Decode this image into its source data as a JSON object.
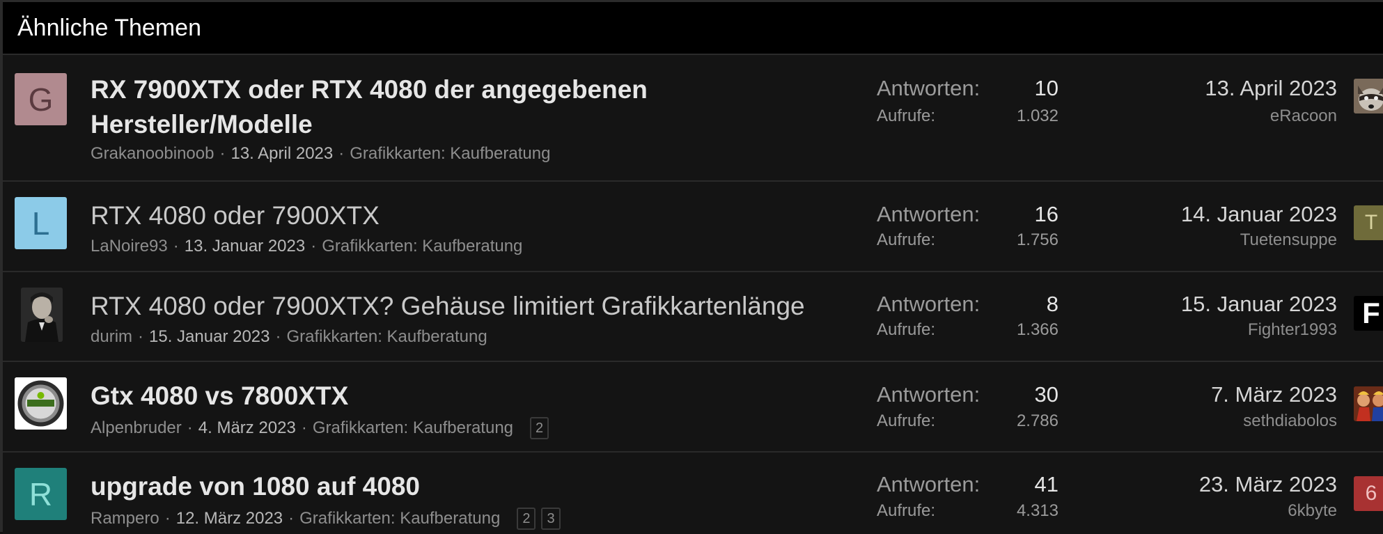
{
  "block": {
    "title": "Ähnliche Themen"
  },
  "labels": {
    "replies": "Antworten:",
    "views": "Aufrufe:"
  },
  "threads": [
    {
      "avatar_letter": "G",
      "avatar_bg": "#b18a8f",
      "avatar_fg": "#5a3a3f",
      "title_line1": "RX 7900XTX oder RTX 4080 der angegebenen",
      "title_line2": "Hersteller/Modelle",
      "author": "Grakanoobinoob",
      "date": "13. April 2023",
      "forum": "Grafikkarten: Kaufberatung",
      "replies": "10",
      "views": "1.032",
      "last_date": "13. April 2023",
      "last_user": "eRacoon",
      "last_avatar_icon": "raccoon-avatar-icon"
    },
    {
      "avatar_letter": "L",
      "avatar_bg": "#8ccbe8",
      "avatar_fg": "#2d6f91",
      "title": "RTX 4080 oder 7900XTX",
      "author": "LaNoire93",
      "date": "13. Januar 2023",
      "forum": "Grafikkarten: Kaufberatung",
      "replies": "16",
      "views": "1.756",
      "last_date": "14. Januar 2023",
      "last_user": "Tuetensuppe",
      "last_avatar_letter": "T",
      "last_avatar_bg": "#6f6b3a",
      "last_avatar_fg": "#d8d3a0"
    },
    {
      "avatar_icon": "portrait-photo-avatar-icon",
      "title": "RTX 4080 oder 7900XTX? Gehäuse limitiert Grafikkartenlänge",
      "author": "durim",
      "date": "15. Januar 2023",
      "forum": "Grafikkarten: Kaufberatung",
      "replies": "8",
      "views": "1.366",
      "last_date": "15. Januar 2023",
      "last_user": "Fighter1993",
      "last_avatar_letter": "F",
      "last_avatar_bg": "#000000",
      "last_avatar_fg": "#ffffff"
    },
    {
      "avatar_icon": "nvidia-badge-avatar-icon",
      "title": "Gtx 4080 vs 7800XTX",
      "author": "Alpenbruder",
      "date": "4. März 2023",
      "forum": "Grafikkarten: Kaufberatung",
      "pages": [
        "2"
      ],
      "replies": "30",
      "views": "2.786",
      "last_date": "7. März 2023",
      "last_user": "sethdiabolos",
      "last_avatar_icon": "game-art-avatar-icon"
    },
    {
      "avatar_letter": "R",
      "avatar_bg": "#1f807a",
      "avatar_fg": "#8fe0d8",
      "title": "upgrade von 1080 auf 4080",
      "author": "Rampero",
      "date": "12. März 2023",
      "forum": "Grafikkarten: Kaufberatung",
      "pages": [
        "2",
        "3"
      ],
      "replies": "41",
      "views": "4.313",
      "last_date": "23. März 2023",
      "last_user": "6kbyte",
      "last_avatar_letter": "6",
      "last_avatar_bg": "#a83232",
      "last_avatar_fg": "#f0c0c0"
    }
  ]
}
